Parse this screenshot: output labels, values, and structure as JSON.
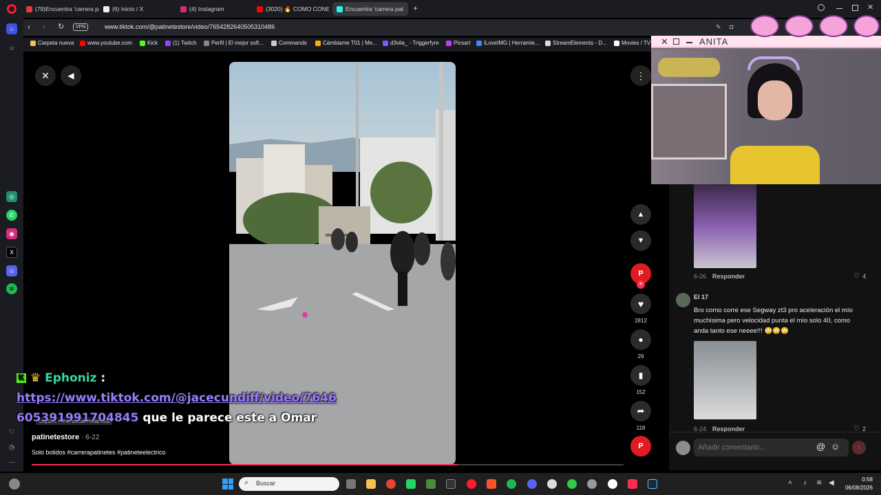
{
  "tabs": [
    {
      "title": "(79)Encuentra 'carrera pat",
      "color": "#e03a3a"
    },
    {
      "title": "(6) Inicio / X",
      "color": "#f0f0f0"
    },
    {
      "title": "(4) Instagram",
      "color": "#d6297b"
    },
    {
      "title": "(3020) 🔥 COMO CONECT",
      "color": "#ff0000"
    },
    {
      "title": "Encuentra 'carrera pat",
      "color": "#25f4ee"
    }
  ],
  "address": {
    "vpn": "VPN",
    "url": "www.tiktok.com/@patinetestore/video/7654282640505310486"
  },
  "bookmarks": [
    {
      "label": "Carpeta nueva",
      "color": "#f2c14e"
    },
    {
      "label": "www.youtube.com",
      "color": "#ff0000"
    },
    {
      "label": "Kick",
      "color": "#53fc18"
    },
    {
      "label": "(1) Twitch",
      "color": "#9146ff"
    },
    {
      "label": "Perfil | El mejor soft...",
      "color": "#888888"
    },
    {
      "label": "Commands",
      "color": "#cccccc"
    },
    {
      "label": "Cámbiame T01 | Me...",
      "color": "#ffb000"
    },
    {
      "label": "d3vila_ - Triggerfyre",
      "color": "#7b5cff"
    },
    {
      "label": "Picsart",
      "color": "#c13cff"
    },
    {
      "label": "iLoveIMG | Herramie...",
      "color": "#3a8bff"
    },
    {
      "label": "StreamElements - D...",
      "color": "#dddddd"
    },
    {
      "label": "Movies / TV",
      "color": "#ffffff"
    }
  ],
  "overlay": {
    "name": "ANITA"
  },
  "post": {
    "watermark": "CapCut · Una edición más fácil",
    "author": "patinetestore",
    "date": "· 6-22",
    "caption": "Solo bolidos #carrerapatinetes #patineteelectrico",
    "likes": "2812",
    "comments": "29",
    "saves": "152",
    "shares": "118"
  },
  "chat": {
    "user": "Ephoniz",
    "colon": ":",
    "link_line1": "https://www.tiktok.com/@jacecundiff/video/7646",
    "link_line2": "605391991704845",
    "text": " que le parece este a Omar"
  },
  "comments": [
    {
      "date": "6-26",
      "reply": "Responder",
      "likes": "4"
    },
    {
      "user": "El 17",
      "text": "Bro como corre ese Segway zt3 pro aceleración el mío muchísima pero velocidad punta el mío solo 40, como anda tanto ese neeee!!! 😳😳😳",
      "date": "6-24",
      "reply": "Responder",
      "likes": "2"
    }
  ],
  "comment_input": {
    "placeholder": "Añadir comentario..."
  },
  "taskbar": {
    "search": "Buscar",
    "time": "0:58",
    "date": "06/08/2026"
  }
}
